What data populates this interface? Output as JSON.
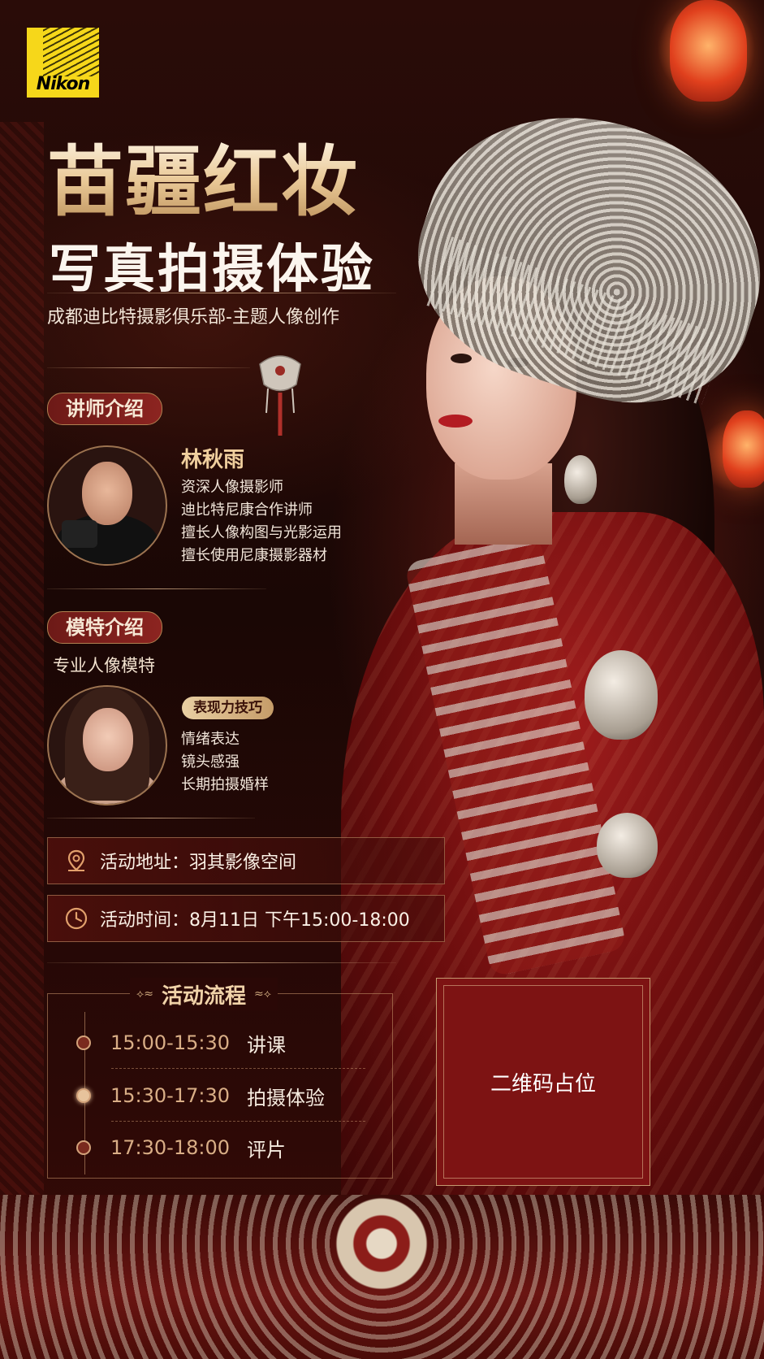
{
  "brand": {
    "logo_text": "Nikon"
  },
  "hero": {
    "title_main": "苗疆红妆",
    "title_sub": "写真拍摄体验",
    "subtitle": "成都迪比特摄影俱乐部-主题人像创作"
  },
  "instructor": {
    "section_label": "讲师介绍",
    "name": "林秋雨",
    "details": [
      "资深人像摄影师",
      "迪比特尼康合作讲师",
      "擅长人像构图与光影运用",
      "擅长使用尼康摄影器材"
    ]
  },
  "model": {
    "section_label": "模特介绍",
    "subtitle": "专业人像模特",
    "badge": "表现力技巧",
    "details": [
      "情绪表达",
      "镜头感强",
      "长期拍摄婚样"
    ]
  },
  "event": {
    "location": "活动地址：羽其影像空间",
    "time": "活动时间：8月11日 下午15:00-18:00"
  },
  "schedule": {
    "title": "活动流程",
    "steps": [
      {
        "time": "15:00-15:30",
        "activity": "讲课"
      },
      {
        "time": "15:30-17:30",
        "activity": "拍摄体验"
      },
      {
        "time": "17:30-18:00",
        "activity": "评片"
      }
    ]
  },
  "qr": {
    "placeholder": "二维码占位"
  },
  "icons": {
    "location": "location-pin-icon",
    "time": "clock-icon",
    "logo": "nikon-logo"
  },
  "colors": {
    "accent_gold": "#e9c896",
    "deep_red": "#7d1313",
    "background": "#1e0806"
  }
}
